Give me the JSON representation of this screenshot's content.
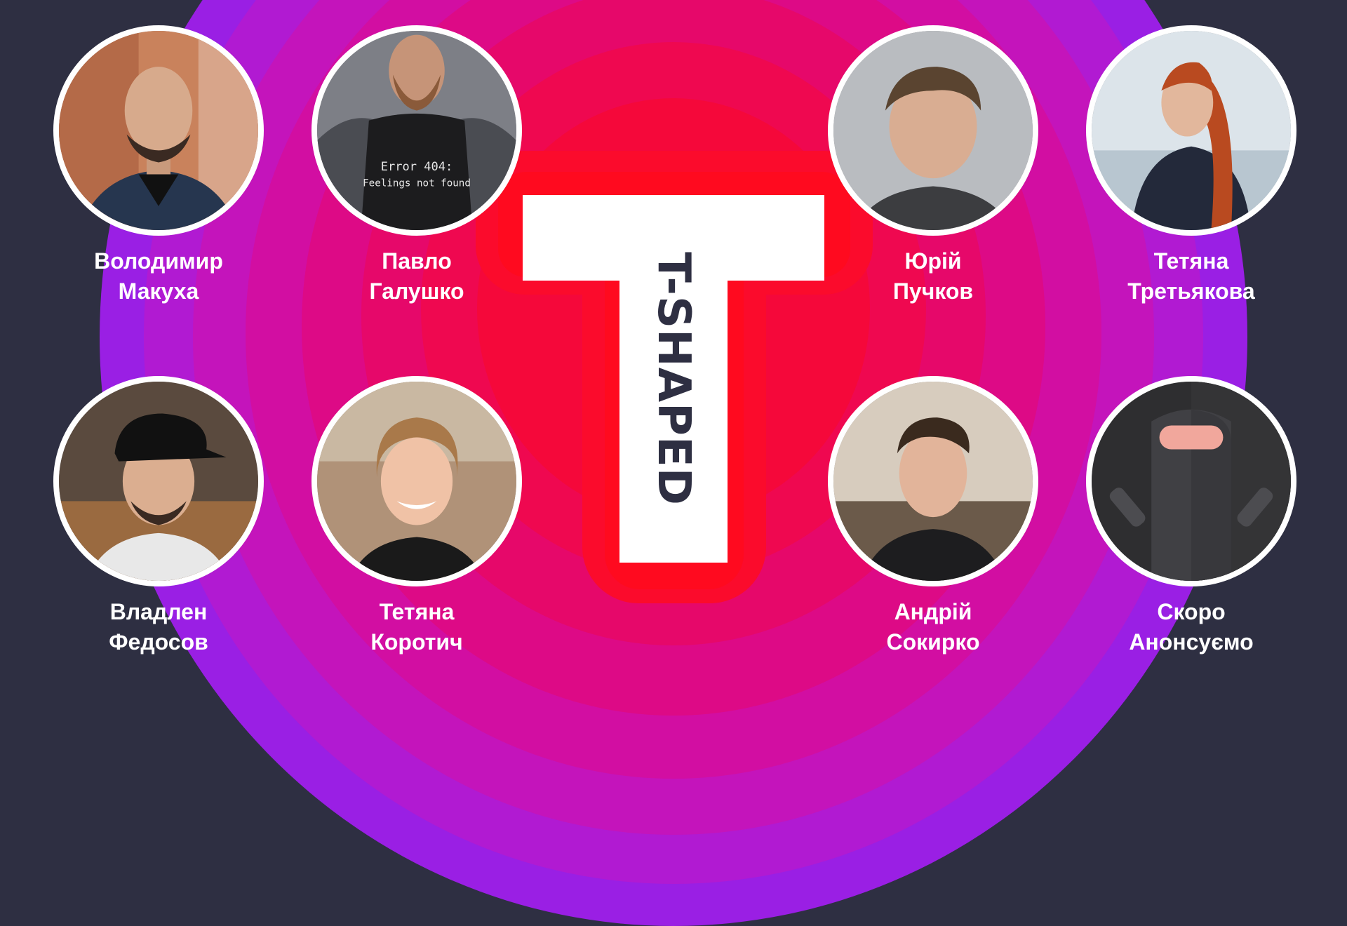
{
  "logo": {
    "text": "T-SHAPED"
  },
  "speakers": [
    {
      "first": "Володимир",
      "last": "Макуха"
    },
    {
      "first": "Павло",
      "last": "Галушко"
    },
    {
      "first": "Юрій",
      "last": "Пучков"
    },
    {
      "first": "Тетяна",
      "last": "Третьякова"
    },
    {
      "first": "Владлен",
      "last": "Федосов"
    },
    {
      "first": "Тетяна",
      "last": "Коротич"
    },
    {
      "first": "Андрій",
      "last": "Сокирко"
    },
    {
      "first": "Скоро",
      "last": "Анонсуємо"
    }
  ],
  "photo_shirt_text": {
    "line1": "Error 404:",
    "line2": "Feelings not found"
  },
  "colors": {
    "background": "#2e2f42",
    "outer_ring": "#9a1fe4",
    "inner_red": "#ff0a1f",
    "logo": "#ffffff",
    "logo_text": "#2e2f42"
  }
}
